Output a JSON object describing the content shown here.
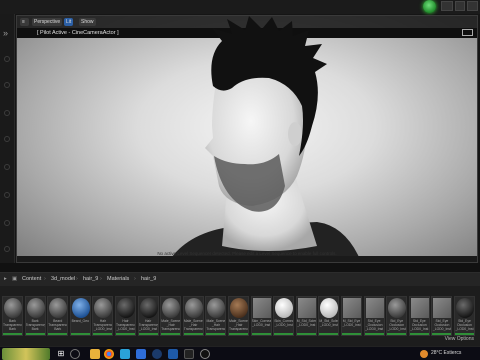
{
  "viewport": {
    "view_mode": "Perspective",
    "lit_mode": "Lit",
    "show": "Show",
    "pilot_text": "[ Pilot Active - CineCameraActor ]",
    "message": "No active Level Sequencer detected. Please edit a Level Sequence to enable full controls."
  },
  "content_browser": {
    "breadcrumb": [
      "Content",
      "3d_model",
      "hair_9",
      "Materials",
      "hair_9"
    ],
    "view_options": "View Options"
  },
  "assets": [
    {
      "label": "Bark\nTransparency\nBark",
      "thumb": "metal"
    },
    {
      "label": "Bark\nTransparency\nBark",
      "thumb": "metal"
    },
    {
      "label": "Beard\nTransparency\nBark",
      "thumb": "metal"
    },
    {
      "label": "Beard_Geo",
      "thumb": "blue"
    },
    {
      "label": "Hair\nTransparency\n_LOD0_Inst",
      "thumb": "metal"
    },
    {
      "label": "Hair\nTransparency\n_LOD0_Inst",
      "thumb": "dark"
    },
    {
      "label": "Hair\nTransparency\n_LOD0_Inst",
      "thumb": "dark"
    },
    {
      "label": "Male_Scene\n_Hair\nTransparency",
      "thumb": "metal"
    },
    {
      "label": "Male_Scene\n_Hair\nTransparency",
      "thumb": "metal"
    },
    {
      "label": "Male_Scene\n_Hair\nTransparency",
      "thumb": "metal"
    },
    {
      "label": "Male_Scene\n_Hair\nTransparency",
      "thumb": "brown"
    },
    {
      "label": "Skin_Cornea\n_LOD0_Inst",
      "thumb": "grey"
    },
    {
      "label": "Skin_Cornea\n_LOD0_Inst",
      "thumb": "white"
    },
    {
      "label": "M_Std_Sclera\n_LOD0_Inst",
      "thumb": "grey"
    },
    {
      "label": "M_Std_Sclera\n_LOD0_Inst",
      "thumb": "white"
    },
    {
      "label": "M_Std_Eye\n_LOD0_Inst",
      "thumb": "grey"
    },
    {
      "label": "Std_Eye\n_Occlusion\n_LOD0_Inst",
      "thumb": "grey"
    },
    {
      "label": "Std_Eye\nOcclusion\n_LOD0_Inst",
      "thumb": "metal"
    },
    {
      "label": "Std_Eye\nOcclusion\n_LOD0_Inst",
      "thumb": "grey"
    },
    {
      "label": "Std_Eye\nOcclusion\n_LOD0_Inst",
      "thumb": "grey"
    },
    {
      "label": "Std_Eye\nOcclusion\n_LOD0_Inst",
      "thumb": "dark"
    }
  ],
  "taskbar": {
    "weather": "28°C Estiercs"
  },
  "colors": {
    "accent_green": "#2f8f38",
    "play_green": "#3fbf4a"
  }
}
